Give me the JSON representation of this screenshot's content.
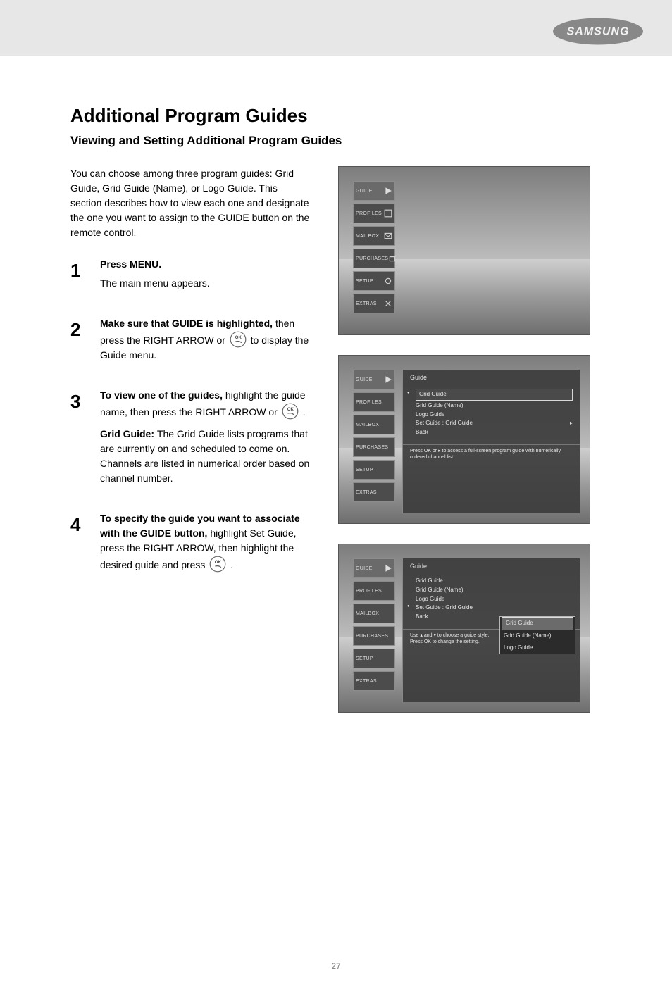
{
  "brand": "SAMSUNG",
  "heading": "Additional Program Guides",
  "subhead": "Viewing and Setting Additional Program Guides",
  "intro": "You can choose among three program guides: Grid Guide, Grid Guide (Name), or Logo Guide. This section describes how to view each one and designate the one you want to assign to the GUIDE button on the remote control.",
  "steps": [
    {
      "num": "1",
      "first": "Press MENU.",
      "rest": "The main menu appears."
    },
    {
      "num": "2",
      "first": "Make sure that GUIDE is highlighted,",
      "rest": "then press the RIGHT ARROW or      to display the Guide menu.",
      "after_icon": " to display the Guide menu."
    },
    {
      "num": "3",
      "first": "To view one of the guides,",
      "rest": "highlight the guide name, then press the RIGHT ARROW or      .",
      "after_icon": ".",
      "option": {
        "label": "Grid Guide: ",
        "text": "The Grid Guide lists programs that are currently on and scheduled to come on. Channels are listed in numerical order based on channel number."
      }
    },
    {
      "num": "4",
      "first": "To specify the guide you want to associate with the GUIDE button,",
      "rest": "highlight Set Guide, press the RIGHT ARROW, then highlight the desired guide and press     .",
      "after_icon": "."
    }
  ],
  "sidemenu": [
    "GUIDE",
    "PROFILES",
    "MAILBOX",
    "PURCHASES",
    "SETUP",
    "EXTRAS"
  ],
  "panel_title": "Guide",
  "guide_items": [
    "Grid Guide",
    "Grid Guide (Name)",
    "Logo Guide",
    "Set Guide : Grid Guide",
    "Back"
  ],
  "hint1": "Press OK or ▸ to access a full-screen program guide with numerically ordered channel list.",
  "hint2": "Use ▴ and ▾ to choose a guide style.\nPress OK to change the setting.",
  "submenu": [
    "Grid Guide",
    "Grid Guide (Name)",
    "Logo Guide"
  ],
  "page_number": "27"
}
